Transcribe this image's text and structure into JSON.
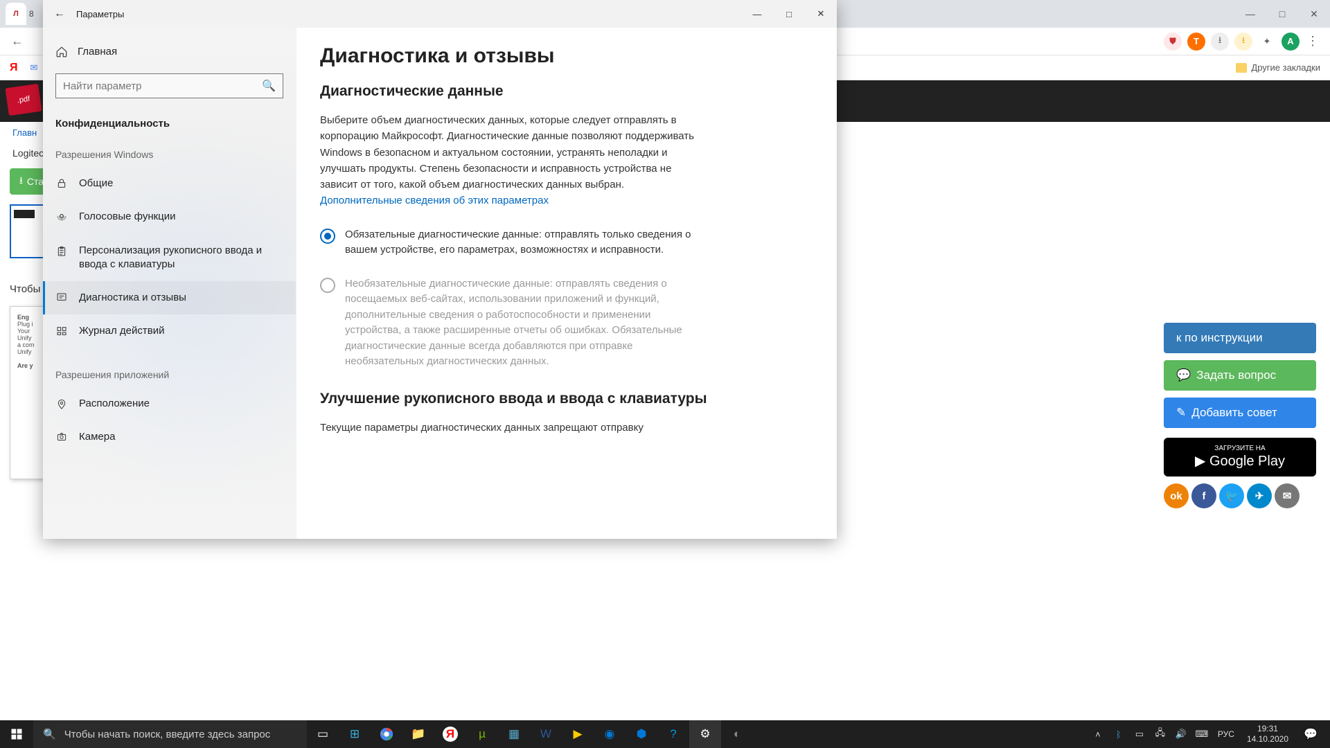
{
  "browser": {
    "tab_badge": "Л",
    "tab_count": "8",
    "min": "—",
    "max": "□",
    "close": "✕",
    "other_bookmarks": "Другие закладки"
  },
  "page_bg": {
    "pdf_label": ".pdf",
    "crumb": "Главн",
    "heading": "Logitech",
    "btn_stat": "Ста",
    "prompt": "Чтобы у",
    "doc_title": "Eng",
    "doc_l1": "Plug i",
    "doc_l2": "Your",
    "doc_l3": "Unify",
    "doc_l4": "a com",
    "doc_l5": "Unify",
    "doc_l6": "Are y",
    "right_btn1": "к по инструкции",
    "right_btn2": "Задать вопрос",
    "right_btn3": "Добавить совет",
    "gplay_small": "ЗАГРУЗИТЕ НА",
    "gplay_big": "Google Play"
  },
  "settings": {
    "win_title": "Параметры",
    "home": "Главная",
    "search_placeholder": "Найти параметр",
    "category": "Конфиденциальность",
    "section_windows": "Разрешения Windows",
    "nav": {
      "general": "Общие",
      "voice": "Голосовые функции",
      "inking": "Персонализация рукописного ввода и ввода с клавиатуры",
      "diagnostics": "Диагностика и отзывы",
      "activity": "Журнал действий"
    },
    "section_apps": "Разрешения приложений",
    "nav2": {
      "location": "Расположение",
      "camera": "Камера"
    }
  },
  "main": {
    "h1": "Диагностика и отзывы",
    "h2": "Диагностические данные",
    "para": "Выберите объем диагностических данных, которые следует отправлять в корпорацию Майкрософт. Диагностические данные позволяют поддерживать Windows в безопасном и актуальном состоянии, устранять неполадки и улучшать продукты. Степень безопасности и исправность устройства не зависит от того, какой объем диагностических данных выбран. ",
    "link": "Дополнительные сведения об этих параметрах",
    "opt1": "Обязательные диагностические данные: отправлять только сведения о вашем устройстве, его параметрах, возможностях и исправности.",
    "opt2": "Необязательные диагностические данные: отправлять сведения о посещаемых веб-сайтах, использовании приложений и функций, дополнительные сведения о работоспособности и применении устройства, а также расширенные отчеты об ошибках. Обязательные диагностические данные всегда добавляются при отправке необязательных диагностических данных.",
    "h3": "Улучшение рукописного ввода и ввода с клавиатуры",
    "warning": "Текущие параметры диагностических данных запрещают отправку"
  },
  "taskbar": {
    "search_placeholder": "Чтобы начать поиск, введите здесь запрос",
    "lang": "РУС",
    "time": "19:31",
    "date": "14.10.2020"
  }
}
